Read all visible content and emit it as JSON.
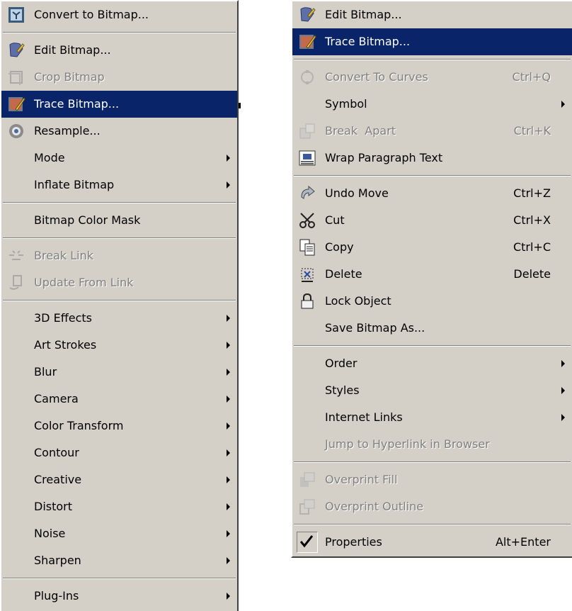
{
  "left_menu": {
    "items": [
      {
        "label": "Convert to Bitmap...",
        "icon": "convert-bitmap-icon"
      },
      {
        "sep": true
      },
      {
        "label": "Edit Bitmap...",
        "icon": "edit-bitmap-icon"
      },
      {
        "label": "Crop Bitmap",
        "icon": "crop-bitmap-icon",
        "disabled": true
      },
      {
        "label": "Trace Bitmap...",
        "icon": "trace-bitmap-icon",
        "selected": true
      },
      {
        "label": "Resample...",
        "icon": "resample-icon"
      },
      {
        "label": "Mode",
        "submenu": true
      },
      {
        "label": "Inflate Bitmap",
        "submenu": true
      },
      {
        "sep": true
      },
      {
        "label": "Bitmap Color Mask"
      },
      {
        "sep": true
      },
      {
        "label": "Break Link",
        "icon": "break-link-icon",
        "disabled": true
      },
      {
        "label": "Update From Link",
        "icon": "update-link-icon",
        "disabled": true
      },
      {
        "sep": true
      },
      {
        "label": "3D Effects",
        "submenu": true
      },
      {
        "label": "Art Strokes",
        "submenu": true
      },
      {
        "label": "Blur",
        "submenu": true
      },
      {
        "label": "Camera",
        "submenu": true
      },
      {
        "label": "Color Transform",
        "submenu": true
      },
      {
        "label": "Contour",
        "submenu": true
      },
      {
        "label": "Creative",
        "submenu": true
      },
      {
        "label": "Distort",
        "submenu": true
      },
      {
        "label": "Noise",
        "submenu": true
      },
      {
        "label": "Sharpen",
        "submenu": true
      },
      {
        "sep": true
      },
      {
        "label": "Plug-Ins",
        "submenu": true
      }
    ]
  },
  "right_menu": {
    "items": [
      {
        "label": "Edit Bitmap...",
        "icon": "edit-bitmap-icon"
      },
      {
        "label": "Trace Bitmap...",
        "icon": "trace-bitmap-icon",
        "selected": true
      },
      {
        "sep": true
      },
      {
        "label": "Convert To Curves",
        "shortcut": "Ctrl+Q",
        "icon": "convert-curves-icon",
        "disabled": true
      },
      {
        "label": "Symbol",
        "submenu": true
      },
      {
        "label": "Break  Apart",
        "shortcut": "Ctrl+K",
        "icon": "break-apart-icon",
        "disabled": true
      },
      {
        "label": "Wrap Paragraph Text",
        "icon": "wrap-text-icon"
      },
      {
        "sep": true
      },
      {
        "label": "Undo Move",
        "shortcut": "Ctrl+Z",
        "icon": "undo-icon"
      },
      {
        "label": "Cut",
        "shortcut": "Ctrl+X",
        "icon": "scissors-icon"
      },
      {
        "label": "Copy",
        "shortcut": "Ctrl+C",
        "icon": "copy-icon"
      },
      {
        "label": "Delete",
        "shortcut": "Delete",
        "icon": "delete-icon"
      },
      {
        "label": "Lock Object",
        "icon": "lock-icon"
      },
      {
        "label": "Save Bitmap As..."
      },
      {
        "sep": true
      },
      {
        "label": "Order",
        "submenu": true
      },
      {
        "label": "Styles",
        "submenu": true
      },
      {
        "label": "Internet Links",
        "submenu": true
      },
      {
        "label": "Jump to Hyperlink in Browser",
        "disabled": true
      },
      {
        "sep": true
      },
      {
        "label": "Overprint Fill",
        "icon": "overprint-fill-icon",
        "disabled": true
      },
      {
        "label": "Overprint Outline",
        "icon": "overprint-outline-icon",
        "disabled": true
      },
      {
        "sep": true
      },
      {
        "label": "Properties",
        "shortcut": "Alt+Enter",
        "checked": true
      }
    ]
  },
  "colors": {
    "menu_bg": "#d4d0c8",
    "highlight": "#0a246a",
    "disabled": "#808080"
  }
}
